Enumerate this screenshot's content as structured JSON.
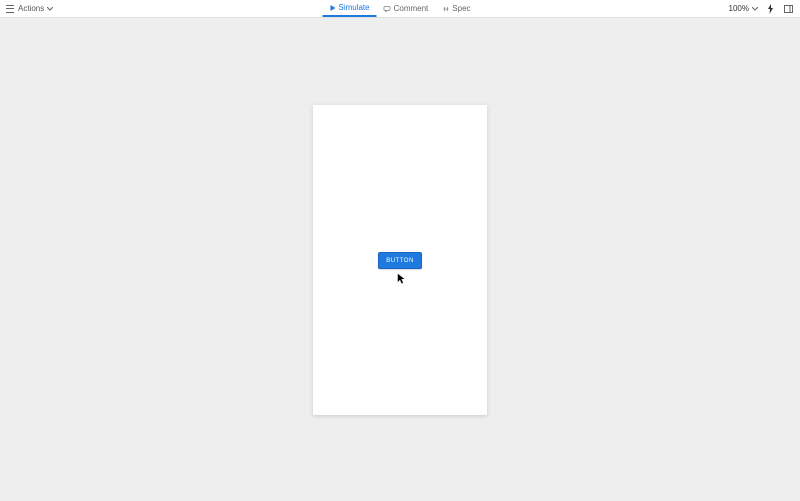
{
  "toolbar": {
    "actions_label": "Actions",
    "tabs": {
      "simulate": "Simulate",
      "comment": "Comment",
      "spec": "Spec"
    },
    "zoom_level": "100%"
  },
  "canvas": {
    "button_label": "BUTTON"
  },
  "colors": {
    "accent": "#1f7ae0",
    "canvas_bg": "#eeeeee"
  }
}
